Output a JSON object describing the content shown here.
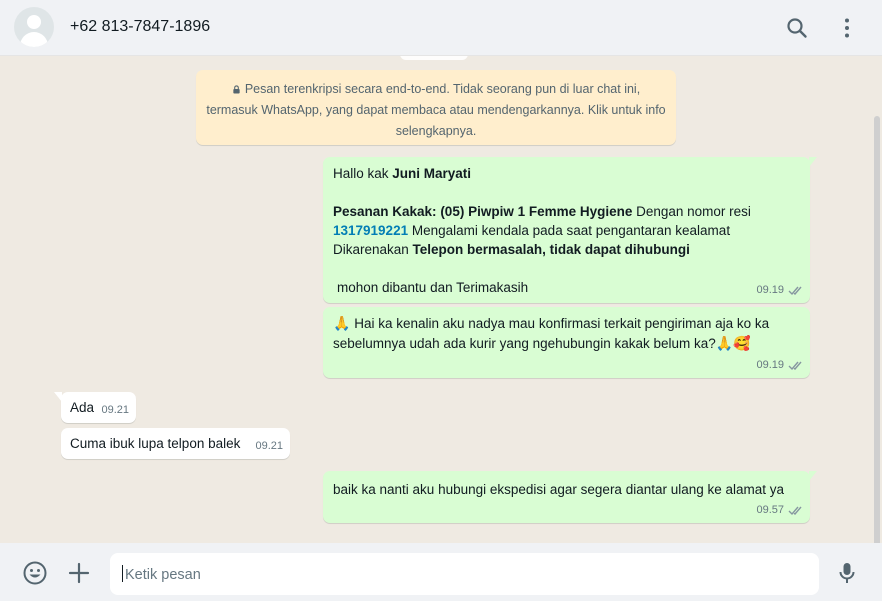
{
  "header": {
    "contact_name": "+62 813-7847-1896",
    "icons": [
      "search-icon",
      "menu-icon"
    ]
  },
  "notice": {
    "text": "Pesan terenkripsi secara end-to-end. Tidak seorang pun di luar chat ini, termasuk WhatsApp, yang dapat membaca atau mendengarkannya. Klik untuk info selengkapnya."
  },
  "messages": [
    {
      "direction": "out",
      "greeting_prefix": "Hallo kak ",
      "greeting_name": "Juni Maryati",
      "order_prefix": "Pesanan Kakak: ",
      "order_product": "(05) Piwpiw 1 Femme Hygiene",
      "order_suffix": " Dengan nomor resi",
      "resi": "1317919221",
      "resi_suffix": " Mengalami kendala pada saat pengantaran kealamat",
      "reason_prefix": "Dikarenakan ",
      "reason": "Telepon bermasalah, tidak dapat dihubungi",
      "closing": "mohon dibantu dan Terimakasih",
      "time": "09.19"
    },
    {
      "direction": "out",
      "emoji_start": "🙏",
      "line1": "Hai ka kenalin aku nadya mau konfirmasi terkait pengiriman aja ko ka",
      "line2": "sebelumnya udah ada kurir yang ngehubungin kakak belum ka?",
      "emoji_end": "🙏🥰",
      "time": "09.19"
    },
    {
      "direction": "in",
      "text": "Ada",
      "time": "09.21"
    },
    {
      "direction": "in",
      "text": "Cuma ibuk lupa telpon balek",
      "time": "09.21"
    },
    {
      "direction": "out",
      "text": "baik ka nanti aku hubungi ekspedisi agar segera diantar ulang ke alamat ya",
      "time": "09.57"
    }
  ],
  "composer": {
    "placeholder": "Ketik pesan",
    "icons": [
      "emoji-icon",
      "plus-icon",
      "mic-icon"
    ]
  },
  "colors": {
    "chat_bg": "#efeae2",
    "outgoing_bubble": "#d9fdd3",
    "incoming_bubble": "#ffffff",
    "notice_bg": "#ffeecd",
    "link": "#027eb5"
  }
}
